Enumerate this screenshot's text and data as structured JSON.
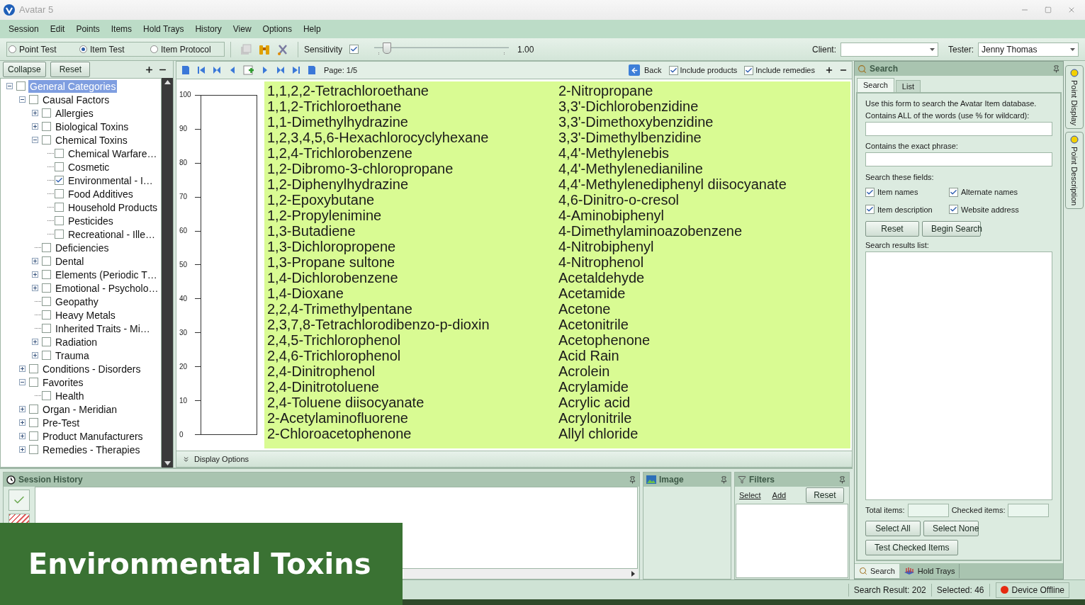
{
  "window": {
    "title": "Avatar 5"
  },
  "menu": [
    "Session",
    "Edit",
    "Points",
    "Items",
    "Hold Trays",
    "History",
    "View",
    "Options",
    "Help"
  ],
  "toolbar": {
    "modes": [
      {
        "label": "Point Test",
        "selected": false
      },
      {
        "label": "Item Test",
        "selected": true
      },
      {
        "label": "Item Protocol",
        "selected": false
      }
    ],
    "sensitivity": {
      "label": "Sensitivity",
      "checked": true,
      "level": 0.07,
      "reading": "1.00"
    },
    "client": {
      "label": "Client:"
    },
    "tester": {
      "label": "Tester:",
      "value": "Jenny Thomas"
    }
  },
  "tree_panel": {
    "buttons": [
      "Collapse",
      "Reset"
    ],
    "tree": [
      {
        "label": "General Categories",
        "kind": "folder",
        "expanded": true,
        "checked": false,
        "selected": true,
        "children": [
          {
            "label": "Causal Factors",
            "kind": "folder",
            "expanded": true,
            "checked": false,
            "selected": false,
            "children": [
              {
                "label": "Allergies",
                "kind": "folder",
                "expanded": false,
                "checked": false,
                "selected": false
              },
              {
                "label": "Biological Toxins",
                "kind": "folder",
                "expanded": false,
                "checked": false,
                "selected": false
              },
              {
                "label": "Chemical Toxins",
                "kind": "folder",
                "expanded": true,
                "checked": false,
                "selected": false,
                "children": [
                  {
                    "label": "Chemical Warfare…",
                    "kind": "leaf",
                    "checked": false,
                    "selected": false
                  },
                  {
                    "label": "Cosmetic",
                    "kind": "leaf",
                    "checked": false,
                    "selected": false
                  },
                  {
                    "label": "Environmental - I…",
                    "kind": "leaf",
                    "checked": true,
                    "selected": false
                  },
                  {
                    "label": "Food Additives",
                    "kind": "leaf",
                    "checked": false,
                    "selected": false
                  },
                  {
                    "label": "Household Products",
                    "kind": "leaf",
                    "checked": false,
                    "selected": false
                  },
                  {
                    "label": "Pesticides",
                    "kind": "leaf",
                    "checked": false,
                    "selected": false
                  },
                  {
                    "label": "Recreational - Ille…",
                    "kind": "leaf",
                    "checked": false,
                    "selected": false
                  }
                ]
              },
              {
                "label": "Deficiencies",
                "kind": "leaf",
                "checked": false,
                "selected": false
              },
              {
                "label": "Dental",
                "kind": "folder",
                "expanded": false,
                "checked": false,
                "selected": false
              },
              {
                "label": "Elements (Periodic T…",
                "kind": "folder",
                "expanded": false,
                "checked": false,
                "selected": false
              },
              {
                "label": "Emotional - Psycholo…",
                "kind": "folder",
                "expanded": false,
                "checked": false,
                "selected": false
              },
              {
                "label": "Geopathy",
                "kind": "leaf",
                "checked": false,
                "selected": false
              },
              {
                "label": "Heavy Metals",
                "kind": "leaf",
                "checked": false,
                "selected": false
              },
              {
                "label": "Inherited Traits - Mi…",
                "kind": "leaf",
                "checked": false,
                "selected": false
              },
              {
                "label": "Radiation",
                "kind": "folder",
                "expanded": false,
                "checked": false,
                "selected": false
              },
              {
                "label": "Trauma",
                "kind": "folder",
                "expanded": false,
                "checked": false,
                "selected": false
              }
            ]
          },
          {
            "label": "Conditions - Disorders",
            "kind": "folder",
            "expanded": false,
            "checked": false,
            "selected": false
          },
          {
            "label": "Favorites",
            "kind": "folder",
            "expanded": true,
            "checked": false,
            "selected": false,
            "children": [
              {
                "label": "Health",
                "kind": "leaf",
                "checked": false,
                "selected": false
              }
            ]
          },
          {
            "label": "Organ - Meridian",
            "kind": "folder",
            "expanded": false,
            "checked": false,
            "selected": false
          },
          {
            "label": "Pre-Test",
            "kind": "folder",
            "expanded": false,
            "checked": false,
            "selected": false
          },
          {
            "label": "Product Manufacturers",
            "kind": "folder",
            "expanded": false,
            "checked": false,
            "selected": false
          },
          {
            "label": "Remedies - Therapies",
            "kind": "folder",
            "expanded": false,
            "checked": false,
            "selected": false
          }
        ]
      }
    ]
  },
  "item_panel": {
    "page": "Page: 1/5",
    "back": "Back",
    "options": [
      {
        "label": "Include products",
        "checked": true
      },
      {
        "label": "Include remedies",
        "checked": true
      }
    ],
    "scale_labels": [
      "100",
      "90",
      "80",
      "70",
      "60",
      "50",
      "40",
      "30",
      "20",
      "10",
      "0"
    ],
    "items": [
      "1,1,2,2-Tetrachloroethane",
      "1,1,2-Trichloroethane",
      "1,1-Dimethylhydrazine",
      "1,2,3,4,5,6-Hexachlorocyclyhexane",
      "1,2,4-Trichlorobenzene",
      "1,2-Dibromo-3-chloropropane",
      "1,2-Diphenylhydrazine",
      "1,2-Epoxybutane",
      "1,2-Propylenimine",
      "1,3-Butadiene",
      "1,3-Dichloropropene",
      "1,3-Propane sultone",
      "1,4-Dichlorobenzene",
      "1,4-Dioxane",
      "2,2,4-Trimethylpentane",
      "2,3,7,8-Tetrachlorodibenzo-p-dioxin",
      "2,4,5-Trichlorophenol",
      "2,4,6-Trichlorophenol",
      "2,4-Dinitrophenol",
      "2,4-Dinitrotoluene",
      "2,4-Toluene diisocyanate",
      "2-Acetylaminofluorene",
      "2-Chloroacetophenone",
      "2-Nitropropane",
      "3,3'-Dichlorobenzidine",
      "3,3'-Dimethoxybenzidine",
      "3,3'-Dimethylbenzidine",
      "4,4'-Methylenebis",
      "4,4'-Methylenedianiline",
      "4,4'-Methylenediphenyl diisocyanate",
      "4,6-Dinitro-o-cresol",
      "4-Aminobiphenyl",
      "4-Dimethylaminoazobenzene",
      "4-Nitrobiphenyl",
      "4-Nitrophenol",
      "Acetaldehyde",
      "Acetamide",
      "Acetone",
      "Acetonitrile",
      "Acetophenone",
      "Acid Rain",
      "Acrolein",
      "Acrylamide",
      "Acrylic acid",
      "Acrylonitrile",
      "Allyl chloride"
    ],
    "display_options": "Display Options"
  },
  "search_panel": {
    "title": "Search",
    "tabs": [
      {
        "label": "Search",
        "selected": true
      },
      {
        "label": "List",
        "selected": false
      }
    ],
    "intro": "Use this form to search the Avatar Item database.",
    "fields": [
      {
        "label": "Contains ALL of the words (use % for wildcard):"
      },
      {
        "label": "Contains the exact phrase:"
      }
    ],
    "fields_label": "Search these fields:",
    "checkboxes": [
      {
        "label": "Item names",
        "checked": true
      },
      {
        "label": "Alternate names",
        "checked": true
      },
      {
        "label": "Item description",
        "checked": true
      },
      {
        "label": "Website address",
        "checked": true
      }
    ],
    "buttons": [
      "Reset",
      "Begin Search"
    ],
    "results_label": "Search results list:",
    "totals": [
      {
        "label": "Total items:"
      },
      {
        "label": "Checked items:"
      }
    ],
    "select_buttons": [
      "Select All",
      "Select None"
    ],
    "test_button": "Test Checked Items",
    "bottom_tabs": [
      {
        "label": "Search",
        "selected": true
      },
      {
        "label": "Hold Trays",
        "selected": false
      }
    ]
  },
  "side_tabs": [
    "Point Display",
    "Point Description"
  ],
  "session_history": {
    "title": "Session History"
  },
  "image_panel": {
    "title": "Image"
  },
  "filters": {
    "title": "Filters",
    "links": [
      "Select",
      "Add"
    ],
    "button": "Reset"
  },
  "status_bar": {
    "search_result": "Search Result: 202",
    "selected": "Selected: 46",
    "device": "Device Offline"
  },
  "caption_banner": "Environmental Toxins"
}
